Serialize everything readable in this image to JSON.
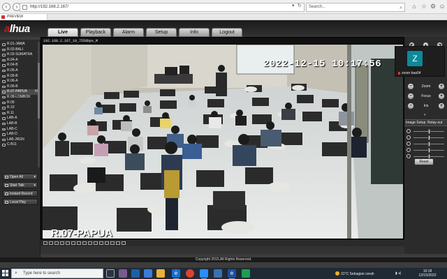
{
  "browser": {
    "url": "http://192.168.2.167/",
    "search_placeholder": "Search...",
    "tab_title": "PREVIEW"
  },
  "app": {
    "logo": "alhua",
    "menu": [
      "Live",
      "Playback",
      "Alarm",
      "Setup",
      "Info",
      "Logout"
    ],
    "active_menu": "Live"
  },
  "channels": [
    {
      "label": "R.01-JAWA",
      "marker": ""
    },
    {
      "label": "R.02-BALI",
      "marker": ""
    },
    {
      "label": "R.03-SUMATRA",
      "marker": ""
    },
    {
      "label": "R.04-A",
      "marker": ""
    },
    {
      "label": "R.04-B",
      "marker": ""
    },
    {
      "label": "R.05-A",
      "marker": ""
    },
    {
      "label": "R.05-B",
      "marker": ""
    },
    {
      "label": "R.06-A",
      "marker": ""
    },
    {
      "label": "R.06-B",
      "marker": ""
    },
    {
      "label": "R.07-PAPUA",
      "marker": "M"
    },
    {
      "label": "R.08-LOMBOK",
      "marker": ""
    },
    {
      "label": "R.09",
      "marker": ""
    },
    {
      "label": "R.10",
      "marker": ""
    },
    {
      "label": "R.11",
      "marker": ""
    },
    {
      "label": "LAB-A",
      "marker": ""
    },
    {
      "label": "LAB-B",
      "marker": ""
    },
    {
      "label": "LAB-C",
      "marker": ""
    },
    {
      "label": "LAB-D",
      "marker": ""
    },
    {
      "label": "LAB-JRGN",
      "marker": ""
    },
    {
      "label": "C-B11",
      "marker": ""
    }
  ],
  "left_buttons": {
    "open_all": "Open All",
    "start_talk": "Start Talk",
    "instant_record": "Instant Record",
    "local_play": "Local Play"
  },
  "video": {
    "caption": "192.168.2.167_10_7558bps_M",
    "timestamp": "2022-12-15 10:17:56",
    "room_label": "R.07-PAPUA"
  },
  "ptz": {
    "zoom_label": "Zoom",
    "focus_label": "Focus",
    "iris_label": "Iris",
    "plus": "+",
    "minus": "−"
  },
  "image_setup": {
    "tab_image": "Image Setup",
    "tab_relay": "Relay-out",
    "reset_label": "Reset",
    "sliders": [
      0.5,
      0.5,
      0.5,
      0.5,
      0.5
    ]
  },
  "zoom_overlay": {
    "initial": "Z",
    "name": "zoom baa04"
  },
  "footer": {
    "copyright": "Copyright 2015,All Rights Reserved."
  },
  "taskbar": {
    "search_placeholder": "Type here to search",
    "weather": "31°C  Sebagian cerah",
    "time": "10:18",
    "date": "12/15/2022"
  },
  "colors": {
    "brand_red": "#c8191e",
    "zoom_teal": "#0b8a9a",
    "taskbar": "#202a35"
  }
}
